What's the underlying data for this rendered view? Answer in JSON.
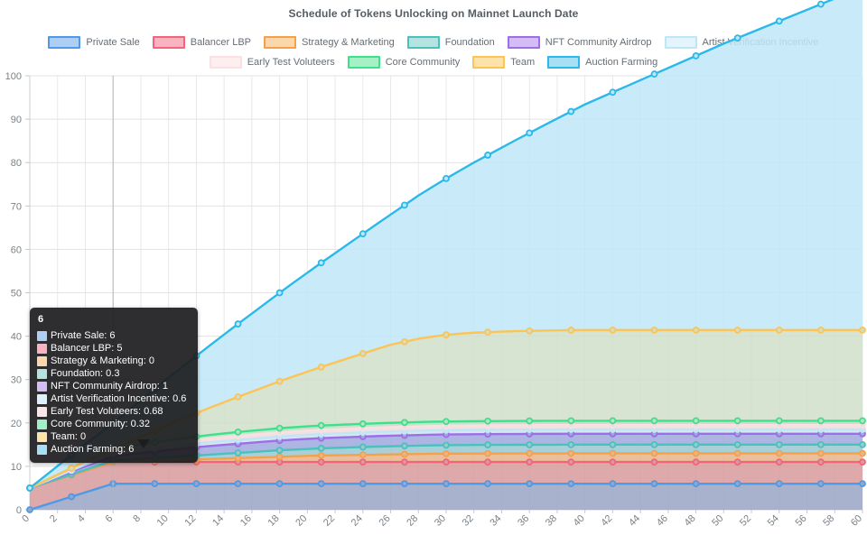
{
  "chart_data": {
    "type": "area",
    "stacked": true,
    "title": "Schedule of Tokens Unlocking on Mainnet Launch Date",
    "xlabel": "",
    "ylabel": "",
    "xlim": [
      0,
      60
    ],
    "ylim": [
      0,
      100
    ],
    "grid": true,
    "legend_position": "top",
    "x": [
      0,
      1,
      2,
      3,
      4,
      5,
      6,
      7,
      8,
      9,
      10,
      11,
      12,
      13,
      14,
      15,
      16,
      17,
      18,
      19,
      20,
      21,
      22,
      23,
      24,
      25,
      26,
      27,
      28,
      29,
      30,
      31,
      32,
      33,
      34,
      35,
      36,
      37,
      38,
      39,
      40,
      41,
      42,
      43,
      44,
      45,
      46,
      47,
      48,
      49,
      50,
      51,
      52,
      53,
      54,
      55,
      56,
      57,
      58,
      59,
      60
    ],
    "ytick_labels": [
      "0",
      "10",
      "20",
      "30",
      "40",
      "50",
      "60",
      "70",
      "80",
      "90",
      "100"
    ],
    "xtick_labels": [
      "0",
      "2",
      "4",
      "6",
      "8",
      "10",
      "12",
      "14",
      "16",
      "18",
      "20",
      "22",
      "24",
      "26",
      "28",
      "30",
      "32",
      "34",
      "36",
      "38",
      "40",
      "42",
      "44",
      "46",
      "48",
      "50",
      "52",
      "54",
      "56",
      "58",
      "60"
    ],
    "series": [
      {
        "name": "Private Sale",
        "color": "#4e9ae6",
        "fill": "#9aa4c4",
        "values": [
          0,
          1,
          2,
          3,
          4,
          5,
          6,
          6,
          6,
          6,
          6,
          6,
          6,
          6,
          6,
          6,
          6,
          6,
          6,
          6,
          6,
          6,
          6,
          6,
          6,
          6,
          6,
          6,
          6,
          6,
          6,
          6,
          6,
          6,
          6,
          6,
          6,
          6,
          6,
          6,
          6,
          6,
          6,
          6,
          6,
          6,
          6,
          6,
          6,
          6,
          6,
          6,
          6,
          6,
          6,
          6,
          6,
          6,
          6,
          6,
          6
        ]
      },
      {
        "name": "Balancer LBP",
        "color": "#f2637e",
        "fill": "#d89a9c",
        "values": [
          5,
          5,
          5,
          5,
          5,
          5,
          5,
          5,
          5,
          5,
          5,
          5,
          5,
          5,
          5,
          5,
          5,
          5,
          5,
          5,
          5,
          5,
          5,
          5,
          5,
          5,
          5,
          5,
          5,
          5,
          5,
          5,
          5,
          5,
          5,
          5,
          5,
          5,
          5,
          5,
          5,
          5,
          5,
          5,
          5,
          5,
          5,
          5,
          5,
          5,
          5,
          5,
          5,
          5,
          5,
          5,
          5,
          5,
          5,
          5,
          5
        ]
      },
      {
        "name": "Strategy & Marketing",
        "color": "#f5a14b",
        "fill": "#e8b48a",
        "values": [
          0,
          0,
          0,
          0,
          0,
          0,
          0,
          0.1,
          0.2,
          0.3,
          0.4,
          0.5,
          0.6,
          0.7,
          0.8,
          0.9,
          1,
          1.1,
          1.2,
          1.3,
          1.4,
          1.5,
          1.55,
          1.6,
          1.65,
          1.7,
          1.75,
          1.8,
          1.85,
          1.9,
          1.92,
          1.94,
          1.95,
          1.96,
          1.97,
          1.98,
          1.98,
          1.99,
          1.99,
          2,
          2,
          2,
          2,
          2,
          2,
          2,
          2,
          2,
          2,
          2,
          2,
          2,
          2,
          2,
          2,
          2,
          2,
          2,
          2,
          2,
          2
        ]
      },
      {
        "name": "Foundation",
        "color": "#49c2bd",
        "fill": "#9ac8d2",
        "values": [
          0,
          0.05,
          0.1,
          0.15,
          0.2,
          0.25,
          0.3,
          0.4,
          0.5,
          0.6,
          0.7,
          0.8,
          0.9,
          1,
          1.1,
          1.2,
          1.3,
          1.4,
          1.5,
          1.55,
          1.6,
          1.65,
          1.7,
          1.75,
          1.8,
          1.85,
          1.88,
          1.9,
          1.92,
          1.94,
          1.95,
          1.96,
          1.97,
          1.98,
          1.98,
          1.99,
          1.99,
          2,
          2,
          2,
          2,
          2,
          2,
          2,
          2,
          2,
          2,
          2,
          2,
          2,
          2,
          2,
          2,
          2,
          2,
          2,
          2,
          2,
          2,
          2,
          2
        ]
      },
      {
        "name": "NFT Community Airdrop",
        "color": "#9d6ee8",
        "fill": "#9fa8dd",
        "values": [
          0,
          0.2,
          0.4,
          0.6,
          0.8,
          0.9,
          1,
          1.2,
          1.4,
          1.5,
          1.7,
          1.8,
          1.9,
          2,
          2.05,
          2.1,
          2.15,
          2.2,
          2.25,
          2.3,
          2.32,
          2.34,
          2.36,
          2.38,
          2.4,
          2.42,
          2.43,
          2.44,
          2.45,
          2.46,
          2.47,
          2.47,
          2.48,
          2.48,
          2.49,
          2.49,
          2.5,
          2.5,
          2.5,
          2.5,
          2.5,
          2.5,
          2.5,
          2.5,
          2.5,
          2.5,
          2.5,
          2.5,
          2.5,
          2.5,
          2.5,
          2.5,
          2.5,
          2.5,
          2.5,
          2.5,
          2.5,
          2.5,
          2.5,
          2.5,
          2.5
        ]
      },
      {
        "name": "Artist Verification Incentive",
        "color": "#bfe6f7",
        "fill": "#cfe3ef",
        "values": [
          0,
          0.1,
          0.2,
          0.3,
          0.4,
          0.5,
          0.6,
          0.65,
          0.7,
          0.75,
          0.8,
          0.82,
          0.84,
          0.86,
          0.88,
          0.9,
          0.91,
          0.92,
          0.93,
          0.94,
          0.95,
          0.96,
          0.96,
          0.97,
          0.97,
          0.98,
          0.98,
          0.98,
          0.99,
          0.99,
          0.99,
          1,
          1,
          1,
          1,
          1,
          1,
          1,
          1,
          1,
          1,
          1,
          1,
          1,
          1,
          1,
          1,
          1,
          1,
          1,
          1,
          1,
          1,
          1,
          1,
          1,
          1,
          1,
          1,
          1,
          1
        ]
      },
      {
        "name": "Early Test Voluteers",
        "color": "#fbe0e2",
        "fill": "#f0dcdc",
        "values": [
          0,
          0.12,
          0.24,
          0.36,
          0.48,
          0.58,
          0.68,
          0.72,
          0.76,
          0.8,
          0.82,
          0.84,
          0.86,
          0.88,
          0.9,
          0.91,
          0.92,
          0.93,
          0.94,
          0.95,
          0.95,
          0.96,
          0.96,
          0.97,
          0.97,
          0.98,
          0.98,
          0.98,
          0.99,
          0.99,
          0.99,
          1,
          1,
          1,
          1,
          1,
          1,
          1,
          1,
          1,
          1,
          1,
          1,
          1,
          1,
          1,
          1,
          1,
          1,
          1,
          1,
          1,
          1,
          1,
          1,
          1,
          1,
          1,
          1,
          1,
          1
        ]
      },
      {
        "name": "Core Community",
        "color": "#3ee089",
        "fill": "#b9e0c8",
        "values": [
          0,
          0.06,
          0.12,
          0.18,
          0.24,
          0.28,
          0.32,
          0.4,
          0.48,
          0.55,
          0.62,
          0.68,
          0.74,
          0.8,
          0.85,
          0.9,
          0.93,
          0.95,
          0.97,
          0.98,
          0.99,
          1,
          1,
          1,
          1,
          1,
          1,
          1,
          1,
          1,
          1,
          1,
          1,
          1,
          1,
          1,
          1,
          1,
          1,
          1,
          1,
          1,
          1,
          1,
          1,
          1,
          1,
          1,
          1,
          1,
          1,
          1,
          1,
          1,
          1,
          1,
          1,
          1,
          1,
          1,
          1
        ]
      },
      {
        "name": "Team",
        "color": "#fbc455",
        "fill": "#cfdfc9",
        "values": [
          0,
          0,
          0,
          0,
          0,
          0,
          0,
          0.9,
          1.8,
          2.7,
          3.6,
          4.5,
          5.4,
          6.3,
          7.2,
          8.1,
          9,
          9.9,
          10.8,
          11.7,
          12.6,
          13.5,
          14.4,
          15.3,
          16.2,
          17.1,
          18,
          18.6,
          19.2,
          19.6,
          20,
          20.2,
          20.4,
          20.5,
          20.6,
          20.7,
          20.75,
          20.8,
          20.85,
          20.88,
          20.9,
          20.9,
          20.9,
          20.9,
          20.9,
          20.9,
          20.9,
          20.9,
          20.9,
          20.9,
          20.9,
          20.9,
          20.9,
          20.9,
          20.9,
          20.9,
          20.9,
          20.9,
          20.9,
          20.9,
          20.9
        ]
      },
      {
        "name": "Auction Farming",
        "color": "#2bb8ea",
        "fill": "#bfe7f8",
        "values": [
          0,
          1,
          2,
          3,
          4,
          5,
          6,
          7.2,
          8.4,
          9.6,
          10.8,
          12,
          13.2,
          14.4,
          15.6,
          16.8,
          18,
          19.2,
          20.4,
          21.6,
          22.8,
          24,
          25.2,
          26.4,
          27.6,
          28.8,
          30,
          31.5,
          33,
          34.5,
          36,
          37.6,
          39.2,
          40.8,
          42.4,
          44,
          45.6,
          47.2,
          48.8,
          50.4,
          52,
          53.4,
          54.8,
          56.2,
          57.6,
          59,
          60.4,
          61.8,
          63.2,
          64.6,
          66,
          67.3,
          68.6,
          69.9,
          71.2,
          72.5,
          73.8,
          75.1,
          76.4,
          77.7,
          79.1
        ]
      }
    ]
  },
  "legend": {
    "row1": [
      {
        "label": "Private Sale",
        "border": "#4e9ae6",
        "fill": "#aecef3"
      },
      {
        "label": "Balancer LBP",
        "border": "#f2637e",
        "fill": "#f9b3c0"
      },
      {
        "label": "Strategy & Marketing",
        "border": "#f5a14b",
        "fill": "#fbd7ab"
      },
      {
        "label": "Foundation",
        "border": "#49c2bd",
        "fill": "#b5e3e0"
      },
      {
        "label": "NFT Community Airdrop",
        "border": "#9d6ee8",
        "fill": "#d4bdf5"
      },
      {
        "label": "Artist Verification Incentive",
        "border": "#bfe6f7",
        "fill": "#e4f4fc"
      }
    ],
    "row2": [
      {
        "label": "Early Test Voluteers",
        "border": "#fbe0e2",
        "fill": "#fdeff0"
      },
      {
        "label": "Core Community",
        "border": "#3ee089",
        "fill": "#a6f0c6"
      },
      {
        "label": "Team",
        "border": "#fbc455",
        "fill": "#fde3a9"
      },
      {
        "label": "Auction Farming",
        "border": "#2bb8ea",
        "fill": "#a7dff5"
      }
    ]
  },
  "tooltip": {
    "title": "6",
    "rows": [
      {
        "label": "Private Sale: 6",
        "color": "#aecef3"
      },
      {
        "label": "Balancer LBP: 5",
        "color": "#f9b3c0"
      },
      {
        "label": "Strategy & Marketing: 0",
        "color": "#fbd7ab"
      },
      {
        "label": "Foundation: 0.3",
        "color": "#b5e3e0"
      },
      {
        "label": "NFT Community Airdrop: 1",
        "color": "#d4bdf5"
      },
      {
        "label": "Artist Verification Incentive: 0.6",
        "color": "#dff1fb"
      },
      {
        "label": "Early Test Voluteers: 0.68",
        "color": "#fbe6e7"
      },
      {
        "label": "Core Community: 0.32",
        "color": "#9ff0c4"
      },
      {
        "label": "Team: 0",
        "color": "#fde3a9"
      },
      {
        "label": "Auction Farming: 6",
        "color": "#a7dff5"
      }
    ]
  }
}
